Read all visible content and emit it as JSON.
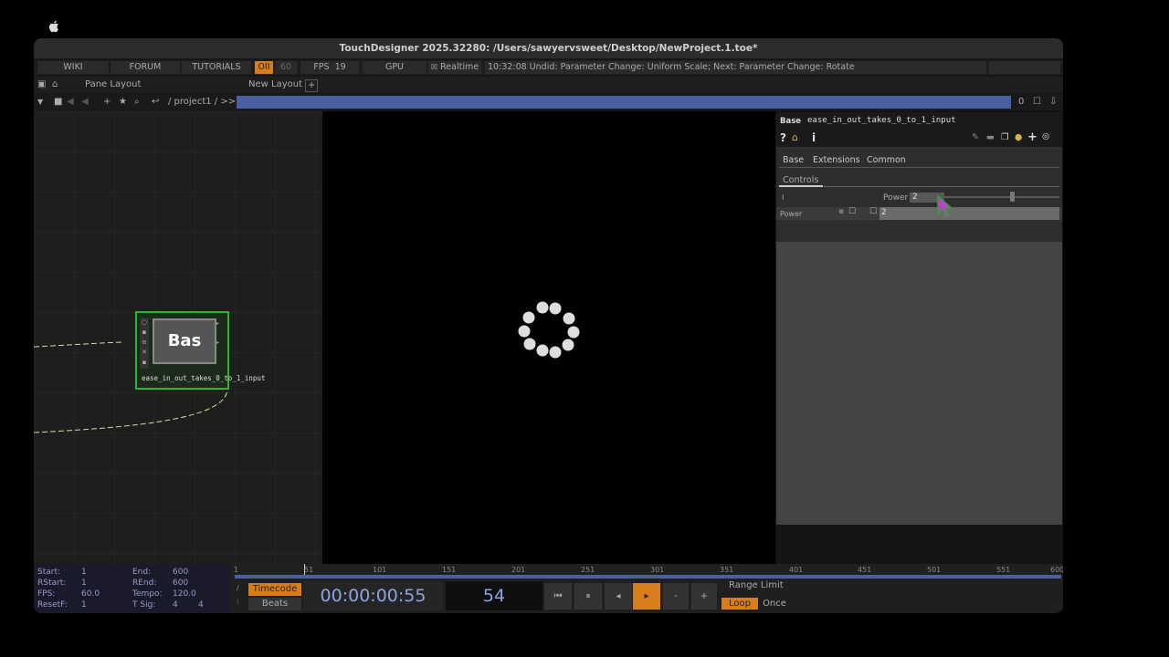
{
  "window": {
    "title": "TouchDesigner 2025.32280: /Users/sawyervsweet/Desktop/NewProject.1.toe*"
  },
  "menubar": {
    "wiki": "WIKI",
    "forum": "FORUM",
    "tutorials": "TUTORIALS",
    "oii": "OII",
    "oii_value": "60",
    "fps_label": "FPS",
    "fps_value": "19",
    "gpu": "GPU",
    "realtime": "Realtime",
    "status": "10:32:08 Undid: Parameter Change: Uniform Scale; Next: Parameter Change: Rotate"
  },
  "toolbar": {
    "pane_layout": "Pane Layout",
    "new_layout": "New Layout"
  },
  "pathbar": {
    "path": "/ project1 / >>",
    "count": "0"
  },
  "node": {
    "label": "Bas",
    "name": "ease_in_out_takes_0_to_1_input"
  },
  "params": {
    "type": "Base",
    "node_name": "ease_in_out_takes_0_to_1_input",
    "tabs": [
      "Base",
      "Extensions",
      "Common"
    ],
    "page": "Controls",
    "row1_label": "I",
    "slider_label": "Power",
    "slider_value": "2",
    "row2_label": "Power",
    "row2_value": "2"
  },
  "timeline": {
    "start_label": "Start:",
    "start": "1",
    "end_label": "End:",
    "end": "600",
    "rstart_label": "RStart:",
    "rstart": "1",
    "rend_label": "REnd:",
    "rend": "600",
    "fps_label": "FPS:",
    "fps": "60.0",
    "tempo_label": "Tempo:",
    "tempo": "120.0",
    "resetf_label": "ResetF:",
    "resetf": "1",
    "tsig_label": "T Sig:",
    "tsig_a": "4",
    "tsig_b": "4",
    "ticks": [
      "1",
      "51",
      "101",
      "151",
      "201",
      "251",
      "301",
      "351",
      "401",
      "451",
      "501",
      "551",
      "600"
    ],
    "timecode_btn": "Timecode",
    "beats_btn": "Beats",
    "timecode": "00:00:00:55",
    "frame": "54",
    "range_limit": "Range Limit",
    "loop": "Loop",
    "once": "Once"
  },
  "colors": {
    "accent": "#d77d1b",
    "node_border": "#2db52d",
    "bar_blue": "#4a5fa0"
  }
}
